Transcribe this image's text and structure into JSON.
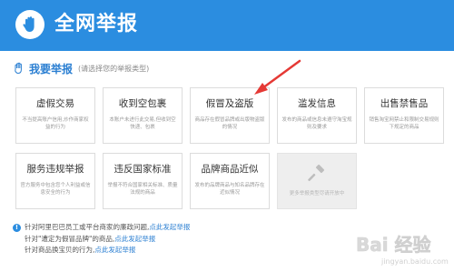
{
  "header": {
    "title": "全网举报",
    "icon": "hand-shield-icon"
  },
  "section": {
    "title": "我要举报",
    "subtitle": "(请选择您的举报类型)",
    "icon": "hand-icon"
  },
  "cards": [
    {
      "title": "虚假交易",
      "desc": "不当提高账户信用,炒作商家权益的行为"
    },
    {
      "title": "收到空包裹",
      "desc": "本账户未进行此交易,但收到空快递、包裹"
    },
    {
      "title": "假冒及盗版",
      "desc": "商品存在假冒品牌或出版物盗版的情况"
    },
    {
      "title": "滥发信息",
      "desc": "发布的商品或信息未遵守淘宝规则及要求"
    },
    {
      "title": "出售禁售品",
      "desc": "销售淘宝网禁止和限制交易规则下规定的商品"
    },
    {
      "title": "服务违规举报",
      "desc": "官方服务中包含您个人利益或信息安全的行为"
    },
    {
      "title": "违反国家标准",
      "desc": "举报不符合国家相关标准、质量法规的商品"
    },
    {
      "title": "品牌商品近似",
      "desc": "发布的品牌商品与知名品牌存在近似情况"
    },
    {
      "title": "",
      "desc": "更多举报类型尽请开放中",
      "icon": "gavel-icon",
      "disabled": true
    }
  ],
  "notes": [
    {
      "text": "针对阿里巴巴员工或平台商家的廉政问题,",
      "link": "点此发起举报"
    },
    {
      "text": "针对\"遭定为假冒品牌\"的商品,",
      "link": "点此发起举报"
    },
    {
      "text": "针对商品换宝贝的行为,",
      "link": "点此发起举报"
    }
  ],
  "watermark": {
    "text": "Bai 经验",
    "sub": "jingyan.baidu.com"
  },
  "colors": {
    "header": "#2b8de0",
    "link": "#2b7fd2",
    "arrow": "#e53935"
  }
}
